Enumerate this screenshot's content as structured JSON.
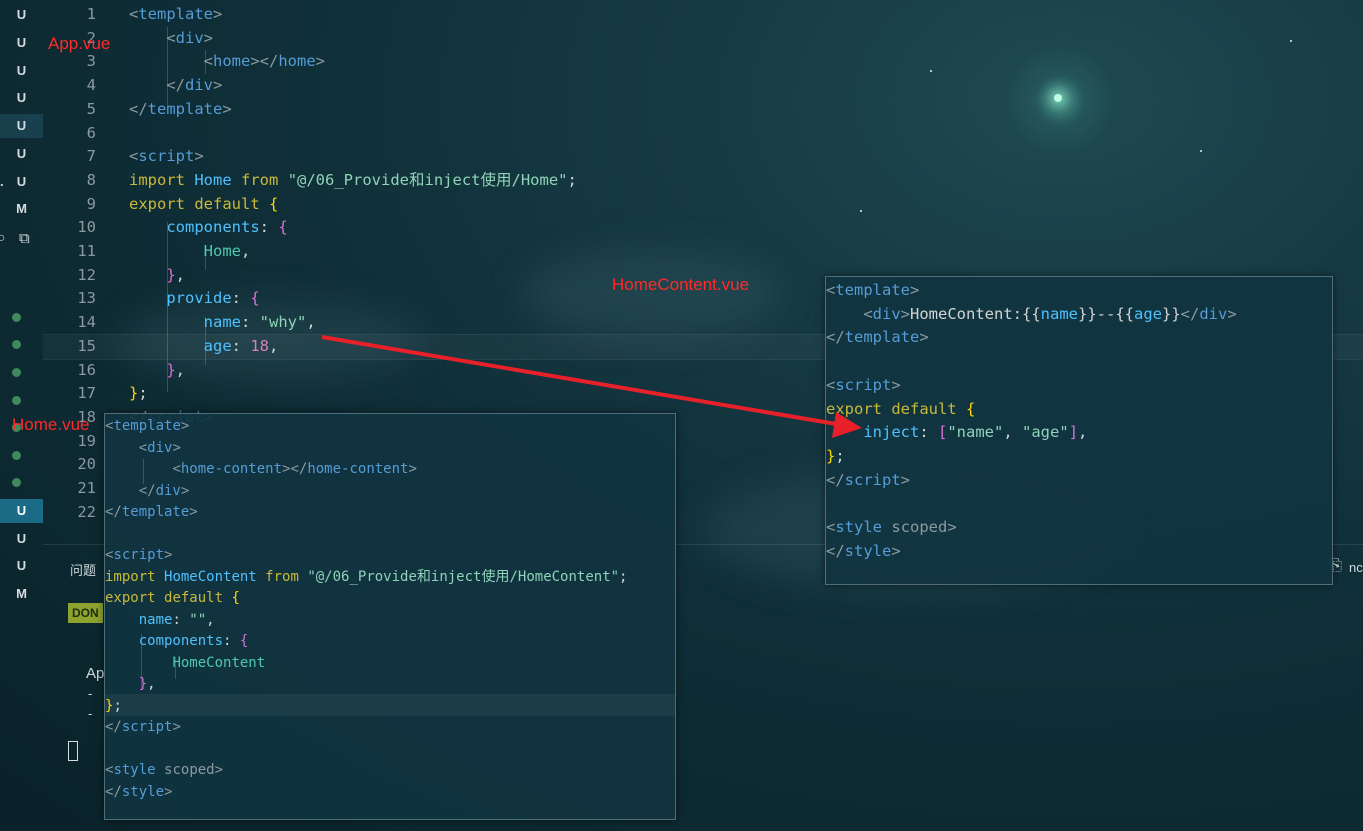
{
  "labels": {
    "app_vue": "App.vue",
    "home_vue": "Home.vue",
    "homecontent_vue": "HomeContent.vue"
  },
  "status_strip": {
    "items": [
      "U",
      "U",
      "U",
      "U",
      "U",
      "U",
      "U",
      "M"
    ],
    "lower_items": [
      "U",
      "U",
      "U",
      "M"
    ],
    "dot_marker": "."
  },
  "icons": [
    "restore-window-icon",
    "git-status-dot-icon",
    "document-icon",
    "text-cursor-icon",
    "red-arrow-icon"
  ],
  "panel": {
    "problems_tab": "问题",
    "done_badge": "DON",
    "ap_text": "Ap",
    "dash1": "-",
    "dash2": "-",
    "right_text": "nc"
  },
  "editor_app": {
    "lines": [
      {
        "n": "1",
        "tokens": [
          [
            "t-bracket",
            "<"
          ],
          [
            "t-tag",
            "template"
          ],
          [
            "t-bracket",
            ">"
          ]
        ]
      },
      {
        "n": "2",
        "tokens": [
          [
            "t-punc",
            "    "
          ],
          [
            "t-bracket",
            "<"
          ],
          [
            "t-tag",
            "div"
          ],
          [
            "t-bracket",
            ">"
          ]
        ]
      },
      {
        "n": "3",
        "tokens": [
          [
            "t-punc",
            "        "
          ],
          [
            "t-bracket",
            "<"
          ],
          [
            "t-tag",
            "home"
          ],
          [
            "t-bracket",
            "></"
          ],
          [
            "t-tag",
            "home"
          ],
          [
            "t-bracket",
            ">"
          ]
        ]
      },
      {
        "n": "4",
        "tokens": [
          [
            "t-punc",
            "    "
          ],
          [
            "t-bracket",
            "</"
          ],
          [
            "t-tag",
            "div"
          ],
          [
            "t-bracket",
            ">"
          ]
        ]
      },
      {
        "n": "5",
        "tokens": [
          [
            "t-bracket",
            "</"
          ],
          [
            "t-tag",
            "template"
          ],
          [
            "t-bracket",
            ">"
          ]
        ]
      },
      {
        "n": "6",
        "tokens": []
      },
      {
        "n": "7",
        "tokens": [
          [
            "t-bracket",
            "<"
          ],
          [
            "t-tag",
            "script"
          ],
          [
            "t-bracket",
            ">"
          ]
        ]
      },
      {
        "n": "8",
        "tokens": [
          [
            "t-kw",
            "import"
          ],
          [
            "t-punc",
            " "
          ],
          [
            "t-prop",
            "Home"
          ],
          [
            "t-punc",
            " "
          ],
          [
            "t-kw",
            "from"
          ],
          [
            "t-punc",
            " "
          ],
          [
            "t-str2",
            "\"@/06_Provide和inject使用/Home\""
          ],
          [
            "t-punc",
            ";"
          ]
        ]
      },
      {
        "n": "9",
        "tokens": [
          [
            "t-kw",
            "export"
          ],
          [
            "t-punc",
            " "
          ],
          [
            "t-kw",
            "default"
          ],
          [
            "t-punc",
            " "
          ],
          [
            "t-brace1",
            "{"
          ]
        ]
      },
      {
        "n": "10",
        "tokens": [
          [
            "t-punc",
            "    "
          ],
          [
            "t-prop",
            "components"
          ],
          [
            "t-punc",
            ": "
          ],
          [
            "t-brace2",
            "{"
          ]
        ]
      },
      {
        "n": "11",
        "tokens": [
          [
            "t-punc",
            "        "
          ],
          [
            "t-id",
            "Home"
          ],
          [
            "t-punc",
            ","
          ]
        ]
      },
      {
        "n": "12",
        "tokens": [
          [
            "t-punc",
            "    "
          ],
          [
            "t-brace2",
            "}"
          ],
          [
            "t-punc",
            ","
          ]
        ]
      },
      {
        "n": "13",
        "tokens": [
          [
            "t-punc",
            "    "
          ],
          [
            "t-prop",
            "provide"
          ],
          [
            "t-punc",
            ": "
          ],
          [
            "t-brace2",
            "{"
          ]
        ]
      },
      {
        "n": "14",
        "tokens": [
          [
            "t-punc",
            "        "
          ],
          [
            "t-prop",
            "name"
          ],
          [
            "t-punc",
            ": "
          ],
          [
            "t-str2",
            "\"why\""
          ],
          [
            "t-punc",
            ","
          ]
        ]
      },
      {
        "n": "15",
        "tokens": [
          [
            "t-punc",
            "        "
          ],
          [
            "t-prop",
            "age"
          ],
          [
            "t-punc",
            ": "
          ],
          [
            "t-num",
            "18"
          ],
          [
            "t-punc",
            ","
          ]
        ]
      },
      {
        "n": "16",
        "tokens": [
          [
            "t-punc",
            "    "
          ],
          [
            "t-brace2",
            "}"
          ],
          [
            "t-punc",
            ","
          ]
        ]
      },
      {
        "n": "17",
        "tokens": [
          [
            "t-brace1",
            "}"
          ],
          [
            "t-punc",
            ";"
          ]
        ]
      },
      {
        "n": "18",
        "tokens": [
          [
            "t-bracket",
            "</"
          ],
          [
            "t-tag",
            "script"
          ],
          [
            "t-bracket",
            ">"
          ]
        ]
      },
      {
        "n": "19",
        "tokens": []
      },
      {
        "n": "20",
        "tokens": []
      },
      {
        "n": "21",
        "tokens": []
      },
      {
        "n": "22",
        "tokens": []
      }
    ]
  },
  "editor_home": {
    "lines": [
      [
        [
          "t-bracket",
          "<"
        ],
        [
          "t-tag",
          "template"
        ],
        [
          "t-bracket",
          ">"
        ]
      ],
      [
        [
          "t-punc",
          "    "
        ],
        [
          "t-bracket",
          "<"
        ],
        [
          "t-tag",
          "div"
        ],
        [
          "t-bracket",
          ">"
        ]
      ],
      [
        [
          "t-punc",
          "        "
        ],
        [
          "t-bracket",
          "<"
        ],
        [
          "t-tag",
          "home-content"
        ],
        [
          "t-bracket",
          "></"
        ],
        [
          "t-tag",
          "home-content"
        ],
        [
          "t-bracket",
          ">"
        ]
      ],
      [
        [
          "t-punc",
          "    "
        ],
        [
          "t-bracket",
          "</"
        ],
        [
          "t-tag",
          "div"
        ],
        [
          "t-bracket",
          ">"
        ]
      ],
      [
        [
          "t-bracket",
          "</"
        ],
        [
          "t-tag",
          "template"
        ],
        [
          "t-bracket",
          ">"
        ]
      ],
      [],
      [
        [
          "t-bracket",
          "<"
        ],
        [
          "t-tag",
          "script"
        ],
        [
          "t-bracket",
          ">"
        ]
      ],
      [
        [
          "t-kw",
          "import"
        ],
        [
          "t-punc",
          " "
        ],
        [
          "t-prop",
          "HomeContent"
        ],
        [
          "t-punc",
          " "
        ],
        [
          "t-kw",
          "from"
        ],
        [
          "t-punc",
          " "
        ],
        [
          "t-str2",
          "\"@/06_Provide和inject使用/HomeContent\""
        ],
        [
          "t-punc",
          ";"
        ]
      ],
      [
        [
          "t-kw",
          "export"
        ],
        [
          "t-punc",
          " "
        ],
        [
          "t-kw",
          "default"
        ],
        [
          "t-punc",
          " "
        ],
        [
          "t-brace1",
          "{"
        ]
      ],
      [
        [
          "t-punc",
          "    "
        ],
        [
          "t-prop",
          "name"
        ],
        [
          "t-punc",
          ": "
        ],
        [
          "t-str2",
          "\"\""
        ],
        [
          "t-punc",
          ","
        ]
      ],
      [
        [
          "t-punc",
          "    "
        ],
        [
          "t-prop",
          "components"
        ],
        [
          "t-punc",
          ": "
        ],
        [
          "t-brace2",
          "{"
        ]
      ],
      [
        [
          "t-punc",
          "        "
        ],
        [
          "t-id",
          "HomeContent"
        ]
      ],
      [
        [
          "t-punc",
          "    "
        ],
        [
          "t-brace2",
          "}"
        ],
        [
          "t-punc",
          ","
        ]
      ],
      [
        [
          "t-brace1",
          "}"
        ],
        [
          "t-punc",
          ";"
        ]
      ],
      [
        [
          "t-bracket",
          "</"
        ],
        [
          "t-tag",
          "script"
        ],
        [
          "t-bracket",
          ">"
        ]
      ],
      [],
      [
        [
          "t-bracket",
          "<"
        ],
        [
          "t-tag",
          "style"
        ],
        [
          "t-punc",
          " "
        ],
        [
          "t-bracket",
          "scoped"
        ],
        [
          "t-bracket",
          ">"
        ]
      ],
      [
        [
          "t-bracket",
          "</"
        ],
        [
          "t-tag",
          "style"
        ],
        [
          "t-bracket",
          ">"
        ]
      ]
    ]
  },
  "editor_homecontent": {
    "lines": [
      [
        [
          "t-bracket",
          "<"
        ],
        [
          "t-tag",
          "template"
        ],
        [
          "t-bracket",
          ">"
        ]
      ],
      [
        [
          "t-punc",
          "    "
        ],
        [
          "t-bracket",
          "<"
        ],
        [
          "t-tag",
          "div"
        ],
        [
          "t-bracket",
          ">"
        ],
        [
          "t-punc",
          "HomeContent:{{"
        ],
        [
          "t-prop",
          "name"
        ],
        [
          "t-punc",
          "}}--{{"
        ],
        [
          "t-prop",
          "age"
        ],
        [
          "t-punc",
          "}}"
        ],
        [
          "t-bracket",
          "</"
        ],
        [
          "t-tag",
          "div"
        ],
        [
          "t-bracket",
          ">"
        ]
      ],
      [
        [
          "t-bracket",
          "</"
        ],
        [
          "t-tag",
          "template"
        ],
        [
          "t-bracket",
          ">"
        ]
      ],
      [],
      [
        [
          "t-bracket",
          "<"
        ],
        [
          "t-tag",
          "script"
        ],
        [
          "t-bracket",
          ">"
        ]
      ],
      [
        [
          "t-kw",
          "export"
        ],
        [
          "t-punc",
          " "
        ],
        [
          "t-kw",
          "default"
        ],
        [
          "t-punc",
          " "
        ],
        [
          "t-brace1",
          "{"
        ]
      ],
      [
        [
          "t-punc",
          "    "
        ],
        [
          "t-prop",
          "inject"
        ],
        [
          "t-punc",
          ": "
        ],
        [
          "t-brace2",
          "["
        ],
        [
          "t-str2",
          "\"name\""
        ],
        [
          "t-punc",
          ", "
        ],
        [
          "t-str2",
          "\"age\""
        ],
        [
          "t-brace2",
          "]"
        ],
        [
          "t-punc",
          ","
        ]
      ],
      [
        [
          "t-brace1",
          "}"
        ],
        [
          "t-punc",
          ";"
        ]
      ],
      [
        [
          "t-bracket",
          "</"
        ],
        [
          "t-tag",
          "script"
        ],
        [
          "t-bracket",
          ">"
        ]
      ],
      [],
      [
        [
          "t-bracket",
          "<"
        ],
        [
          "t-tag",
          "style"
        ],
        [
          "t-punc",
          " "
        ],
        [
          "t-bracket",
          "scoped"
        ],
        [
          "t-bracket",
          ">"
        ]
      ],
      [
        [
          "t-bracket",
          "</"
        ],
        [
          "t-tag",
          "style"
        ],
        [
          "t-bracket",
          ">"
        ]
      ]
    ]
  }
}
